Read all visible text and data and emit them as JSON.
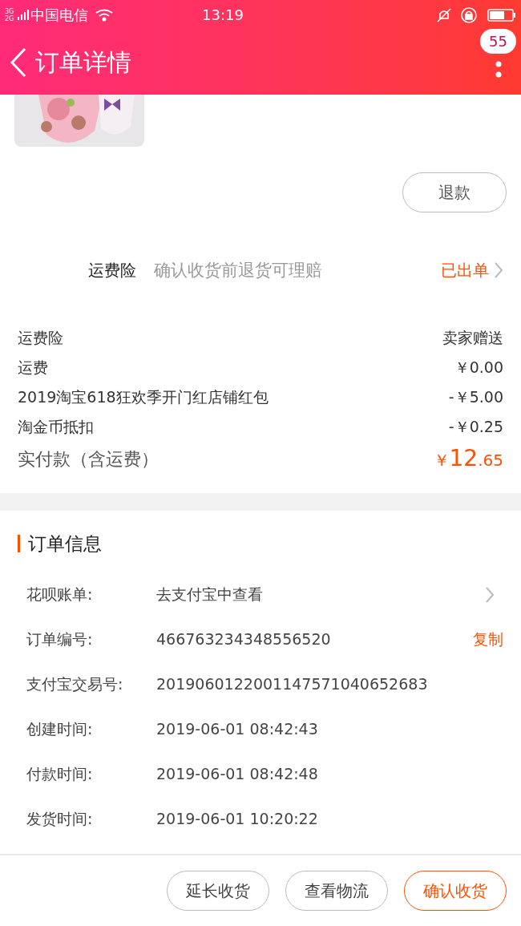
{
  "status_bar": {
    "carrier": "中国电信",
    "network": "3G 2G",
    "time": "13:19"
  },
  "header": {
    "title": "订单详情",
    "badge": "55"
  },
  "product": {
    "kind": "picture",
    "refund_button": "退款"
  },
  "insurance": {
    "label": "运费险",
    "description": "确认收货前退货可理赔",
    "status": "已出单"
  },
  "costs": [
    {
      "label": "运费险",
      "value": "卖家赠送"
    },
    {
      "label": "运费",
      "value": "￥0.00"
    },
    {
      "label": "2019淘宝618狂欢季开门红店铺红包",
      "value": "-￥5.00"
    },
    {
      "label": "淘金币抵扣",
      "value": "-￥0.25"
    }
  ],
  "total": {
    "label": "实付款（含运费）",
    "symbol": "￥",
    "integer": "12",
    "decimal": ".65"
  },
  "order_info": {
    "title": "订单信息",
    "rows": [
      {
        "kind": "link",
        "label": "花呗账单:",
        "value": "去支付宝中查看"
      },
      {
        "kind": "copy",
        "label": "订单编号:",
        "value": "466763234348556520",
        "action": "复制"
      },
      {
        "kind": "plain",
        "label": "支付宝交易号:",
        "value": "2019060122001147571040652683"
      },
      {
        "kind": "plain",
        "label": "创建时间:",
        "value": "2019-06-01 08:42:43"
      },
      {
        "kind": "plain",
        "label": "付款时间:",
        "value": "2019-06-01 08:42:48"
      },
      {
        "kind": "plain",
        "label": "发货时间:",
        "value": "2019-06-01 10:20:22"
      }
    ]
  },
  "actions": [
    {
      "label": "延长收货",
      "kind": "default"
    },
    {
      "label": "查看物流",
      "kind": "default"
    },
    {
      "label": "确认收货",
      "kind": "primary"
    }
  ]
}
